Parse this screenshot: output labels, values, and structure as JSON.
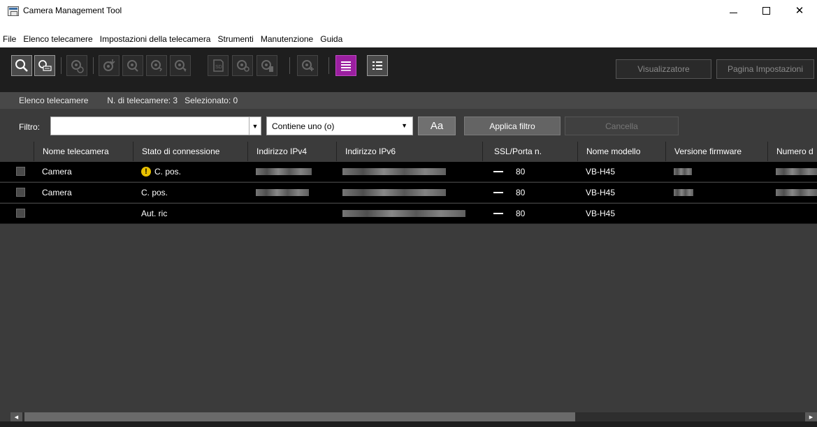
{
  "window": {
    "title": "Camera Management Tool",
    "min": "—",
    "max": "☐",
    "close": "✕"
  },
  "menu": [
    "File",
    "Elenco telecamere",
    "Impostazioni della telecamera",
    "Strumenti",
    "Manutenzione",
    "Guida"
  ],
  "toolbar": {
    "viewer_label": "Visualizzatore",
    "settings_page_label": "Pagina Impostazioni",
    "sd_label": "SD"
  },
  "list": {
    "title": "Elenco telecamere",
    "count": "N. di telecamere: 3",
    "selected": "Selezionato: 0"
  },
  "filter": {
    "label": "Filtro:",
    "value": "",
    "mode": "Contiene uno (o)",
    "case_label": "Aa",
    "apply_label": "Applica filtro",
    "cancel_label": "Cancella"
  },
  "columns": [
    "Nome telecamera",
    "Stato di connessione",
    "Indirizzo IPv4",
    "Indirizzo IPv6",
    "SSL/Porta n.",
    "Nome modello",
    "Versione firmware",
    "Numero d"
  ],
  "rows": [
    {
      "name": "Camera",
      "status": "C. pos.",
      "warning": true,
      "port": "80",
      "model": "VB-H45"
    },
    {
      "name": "Camera",
      "status": "C. pos.",
      "warning": false,
      "port": "80",
      "model": "VB-H45"
    },
    {
      "name": "",
      "status": "Aut. ric",
      "warning": false,
      "port": "80",
      "model": "VB-H45"
    }
  ],
  "colors": {
    "accent_purple": "#9b1fa0",
    "panel": "#3b3b3b",
    "toolbar": "#1e1e1e",
    "warning": "#e8c000"
  }
}
